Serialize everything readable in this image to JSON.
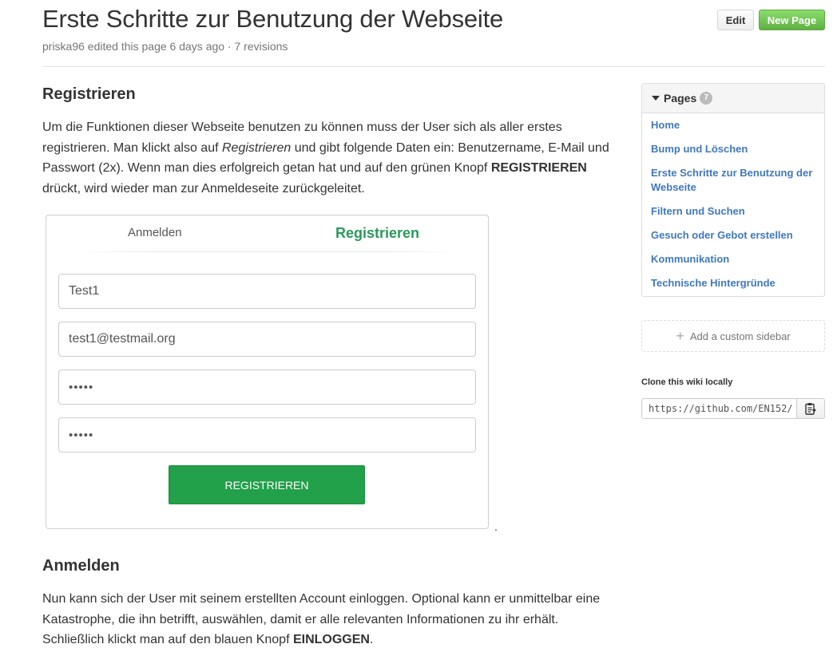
{
  "header": {
    "title": "Erste Schritte zur Benutzung der Webseite",
    "meta": "priska96 edited this page 6 days ago · 7 revisions",
    "edit_label": "Edit",
    "new_page_label": "New Page"
  },
  "sections": {
    "registrieren": {
      "heading": "Registrieren",
      "p_a": "Um die Funktionen dieser Webseite benutzen zu können muss der User sich als aller erstes registrieren. Man klickt also auf ",
      "p_em": "Registrieren",
      "p_b": " und gibt folgende Daten ein: Benutzername, E-Mail und Passwort (2x). Wenn man dies erfolgreich getan hat und auf den grünen Knopf ",
      "p_strong": "REGISTRIEREN",
      "p_c": " drückt, wird wieder man zur Anmeldeseite zurückgeleitet."
    },
    "anmelden": {
      "heading": "Anmelden",
      "p_a": "Nun kann sich der User mit seinem erstellten Account einloggen. Optional kann er unmittelbar eine Katastrophe, die ihn betrifft, auswählen, damit er alle relevanten Informationen zu ihr erhält. Schließlich klickt man auf den blauen Knopf ",
      "p_strong": "EINLOGGEN",
      "p_c": "."
    }
  },
  "form_image": {
    "tab_login": "Anmelden",
    "tab_register": "Registrieren",
    "username": "Test1",
    "email": "test1@testmail.org",
    "password": "•••••",
    "password_repeat": "•••••",
    "submit_label": "REGISTRIEREN",
    "trailing_dot": "."
  },
  "sidebar": {
    "pages_title": "Pages",
    "pages_count": "7",
    "pages": [
      "Home",
      "Bump und Löschen",
      "Erste Schritte zur Benutzung der Webseite",
      "Filtern und Suchen",
      "Gesuch oder Gebot erstellen",
      "Kommunikation",
      "Technische Hintergründe"
    ],
    "add_sidebar_label": "Add a custom sidebar",
    "clone_label": "Clone this wiki locally",
    "clone_url": "https://github.com/EN152/"
  },
  "colors": {
    "link": "#4078c0",
    "new_page_green": "#60b044",
    "register_green": "#22a04a",
    "tab_active": "#2a9a5a"
  },
  "icons": [
    "caret-down-icon",
    "plus-icon",
    "clipboard-icon"
  ]
}
